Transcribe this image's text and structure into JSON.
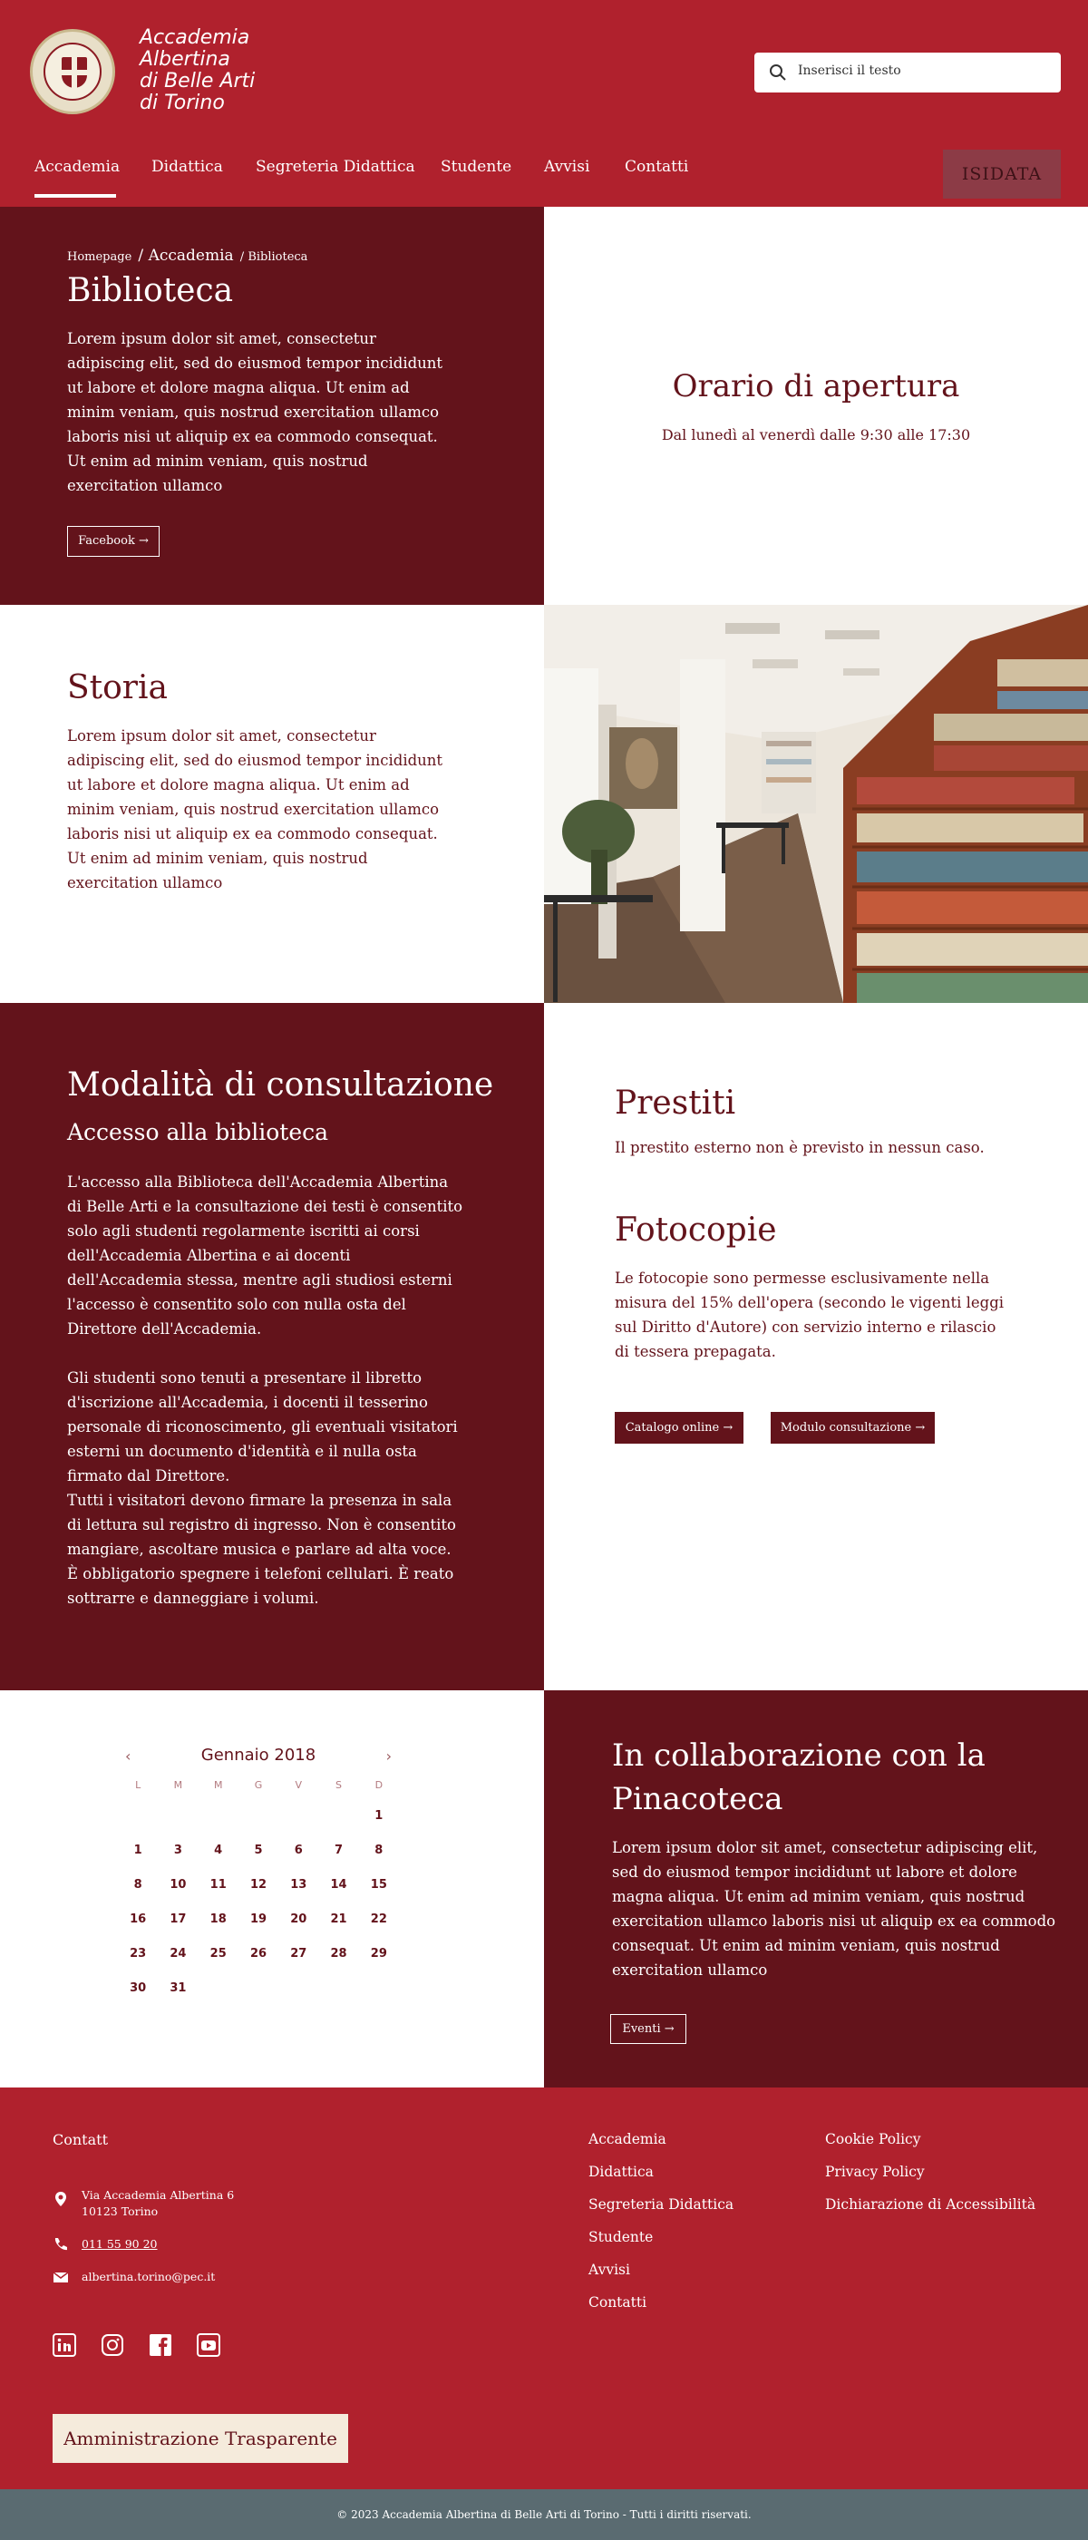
{
  "colors": {
    "brand_red": "#b0212d",
    "dark_red": "#63131b",
    "footer_bar": "#5a6b71",
    "cream": "#f5ebdc"
  },
  "header": {
    "logo_text": "Accademia\nAlbertina\ndi Belle Arti\ndi Torino",
    "search_placeholder": "Inserisci il testo",
    "nav": [
      "Accademia",
      "Didattica",
      "Segreteria Didattica",
      "Studente",
      "Avvisi",
      "Contatti"
    ],
    "isidata_label": "ISIDATA"
  },
  "biblioteca": {
    "breadcrumb": [
      "Homepage",
      "Accademia",
      "Biblioteca"
    ],
    "title": "Biblioteca",
    "text": "Lorem ipsum dolor sit amet, consectetur adipiscing elit, sed do eiusmod tempor incididunt ut labore et dolore magna aliqua. Ut enim ad minim veniam, quis nostrud exercitation ullamco laboris nisi ut aliquip ex ea commodo consequat. Ut enim ad minim veniam, quis nostrud exercitation ullamco",
    "facebook_label": "Facebook →"
  },
  "orario": {
    "title": "Orario di apertura",
    "text": "Dal lunedì al venerdì dalle 9:30 alle 17:30"
  },
  "storia": {
    "title": "Storia",
    "text": "Lorem ipsum dolor sit amet, consectetur adipiscing elit, sed do eiusmod tempor incididunt ut labore et dolore magna aliqua. Ut enim ad minim veniam, quis nostrud exercitation ullamco laboris nisi ut aliquip ex ea commodo consequat. Ut enim ad minim veniam, quis nostrud exercitation ullamco"
  },
  "consultazione": {
    "title": "Modalità di consultazione",
    "subtitle": "Accesso alla biblioteca",
    "p1": "L'accesso alla Biblioteca dell'Accademia Albertina di Belle Arti e la consultazione dei testi è consentito solo agli studenti regolarmente iscritti ai corsi dell'Accademia Albertina e ai docenti dell'Accademia stessa, mentre agli studiosi esterni l'accesso è consentito solo con nulla osta del Direttore dell'Accademia.",
    "p2": "Gli studenti sono tenuti a presentare il libretto d'iscrizione all'Accademia, i docenti il tesserino personale di riconoscimento, gli eventuali visitatori esterni un documento d'identità e il nulla osta firmato dal Direttore.\nTutti i visitatori devono firmare la presenza in sala di lettura sul registro di ingresso. Non è consentito mangiare, ascoltare musica e parlare ad alta voce. È obbligatorio spegnere i telefoni cellulari. È reato sottrarre e danneggiare i volumi."
  },
  "prestiti": {
    "title": "Prestiti",
    "text": "Il prestito esterno non è previsto in nessun caso."
  },
  "fotocopie": {
    "title": "Fotocopie",
    "text": "Le fotocopie sono permesse esclusivamente nella misura del 15% dell'opera (secondo le vigenti leggi sul Diritto d'Autore) con servizio interno e rilascio di tessera prepagata.",
    "btn_catalogo": "Catalogo online →",
    "btn_modulo": "Modulo consultazione →"
  },
  "calendar": {
    "month": "Gennaio 2018",
    "prev": "‹",
    "next": "›",
    "dow": [
      "L",
      "M",
      "M",
      "G",
      "V",
      "S",
      "D"
    ],
    "weeks": [
      [
        "",
        "",
        "",
        "",
        "",
        "",
        "1"
      ],
      [
        "1",
        "3",
        "4",
        "5",
        "6",
        "7",
        "8"
      ],
      [
        "8",
        "10",
        "11",
        "12",
        "13",
        "14",
        "15"
      ],
      [
        "16",
        "17",
        "18",
        "19",
        "20",
        "21",
        "22"
      ],
      [
        "23",
        "24",
        "25",
        "26",
        "27",
        "28",
        "29"
      ],
      [
        "30",
        "31",
        "",
        "",
        "",
        "",
        ""
      ]
    ]
  },
  "collab": {
    "title": "In collaborazione con la Pinacoteca",
    "text": "Lorem ipsum dolor sit amet, consectetur adipiscing elit, sed do eiusmod tempor incididunt ut labore et dolore magna aliqua. Ut enim ad minim veniam, quis nostrud exercitation ullamco laboris nisi ut aliquip ex ea commodo consequat. Ut enim ad minim veniam, quis nostrud exercitation ullamco",
    "eventi_label": "Eventi →"
  },
  "footer": {
    "contact_title": "Contatt",
    "address_line1": "Via Accademia Albertina 6",
    "address_line2": "10123 Torino",
    "phone": "011 55 90 20",
    "email": "albertina.torino@pec.it",
    "col1": [
      "Accademia",
      "Didattica",
      "Segreteria Didattica",
      "Studente",
      "Avvisi",
      "Contatti"
    ],
    "col2": [
      "Cookie Policy",
      "Privacy Policy",
      "Dichiarazione di Accessibilità"
    ],
    "amministrazione": "Amministrazione Trasparente",
    "copyright": "© 2023 Accademia Albertina di Belle Arti di Torino - Tutti i diritti riservati."
  }
}
